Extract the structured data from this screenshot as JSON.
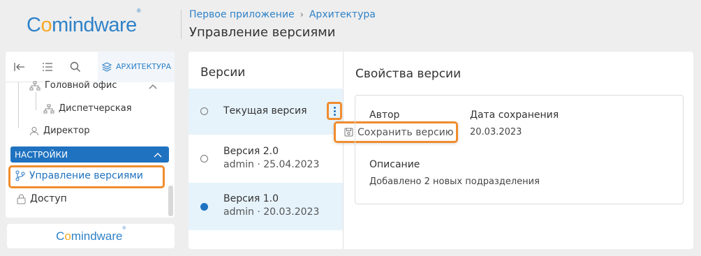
{
  "header": {
    "logo_text_before": "C",
    "logo_text_o": "o",
    "logo_text_after": "mindware",
    "logo_mark": "®",
    "breadcrumb": [
      "Первое приложение",
      "Архитектура"
    ],
    "breadcrumb_sep": "›",
    "title": "Управление версиями"
  },
  "sidebar": {
    "toolbar": {
      "collapse_icon": "collapse-left-icon",
      "list_icon": "list-icon",
      "search_icon": "search-icon",
      "arch_label": "АРХИТЕКТУРА"
    },
    "tree": {
      "head_office": "Головной офис",
      "dispatcher": "Диспетчерская",
      "director": "Директор"
    },
    "section_label": "НАСТРОЙКИ",
    "items": {
      "version_management": "Управление версиями",
      "access": "Доступ"
    },
    "footer_logo_before": "C",
    "footer_logo_o": "o",
    "footer_logo_after": "mindware",
    "footer_logo_mark": "®"
  },
  "versions": {
    "title": "Версии",
    "rows": [
      {
        "name": "Текущая версия",
        "meta": ""
      },
      {
        "name": "Версия 2.0",
        "meta": "admin · 25.04.2023"
      },
      {
        "name": "Версия 1.0",
        "meta": "admin · 20.03.2023"
      }
    ],
    "context_menu": {
      "save_label": "Сохранить версию"
    }
  },
  "properties": {
    "title": "Свойства версии",
    "author_label": "Автор",
    "date_label": "Дата сохранения",
    "date_value": "20.03.2023",
    "description_label": "Описание",
    "description_value": "Добавлено 2 новых подразделения"
  },
  "colors": {
    "accent": "#1f72c0",
    "highlight": "#f08c2e",
    "logo_orange": "#f7a823"
  }
}
